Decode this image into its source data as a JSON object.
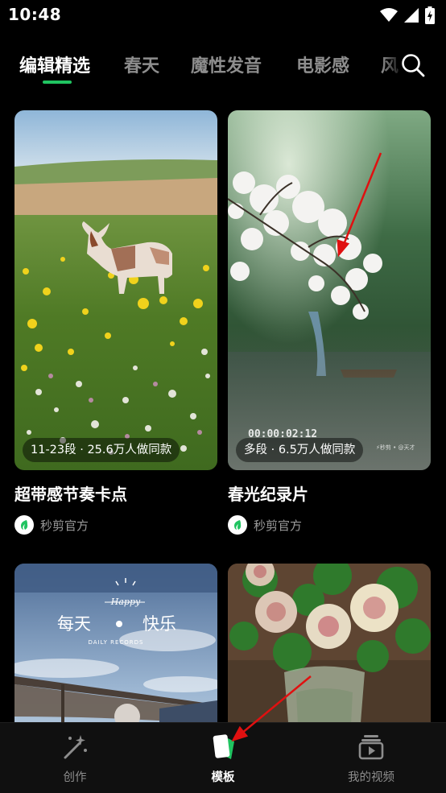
{
  "status_bar": {
    "time": "10:48"
  },
  "tabs": [
    {
      "label": "编辑精选",
      "active": true
    },
    {
      "label": "春天",
      "active": false
    },
    {
      "label": "魔性发音",
      "active": false
    },
    {
      "label": "电影感",
      "active": false
    },
    {
      "label": "风",
      "active": false
    }
  ],
  "cards": [
    {
      "badge": "11-23段 · 25.6万人做同款",
      "title": "超带感节奏卡点",
      "author": "秒剪官方"
    },
    {
      "badge": "多段 · 6.5万人做同款",
      "title": "春光纪录片",
      "author": "秒剪官方",
      "overlay_timecode": "00:00:02:12",
      "overlay_watermark": "⚡秒剪 • @天才"
    },
    {
      "overlay_text_line1": "每天",
      "overlay_text_line2": "快乐",
      "overlay_badge": "Happy",
      "overlay_caption": "DAILY RECORDS"
    },
    {}
  ],
  "bottom_nav": [
    {
      "label": "创作",
      "icon": "magic-wand-icon",
      "active": false
    },
    {
      "label": "模板",
      "icon": "template-card-icon",
      "active": true
    },
    {
      "label": "我的视频",
      "icon": "video-library-icon",
      "active": false
    }
  ],
  "colors": {
    "accent": "#20c461",
    "background": "#000000",
    "annotation": "#e01010"
  }
}
